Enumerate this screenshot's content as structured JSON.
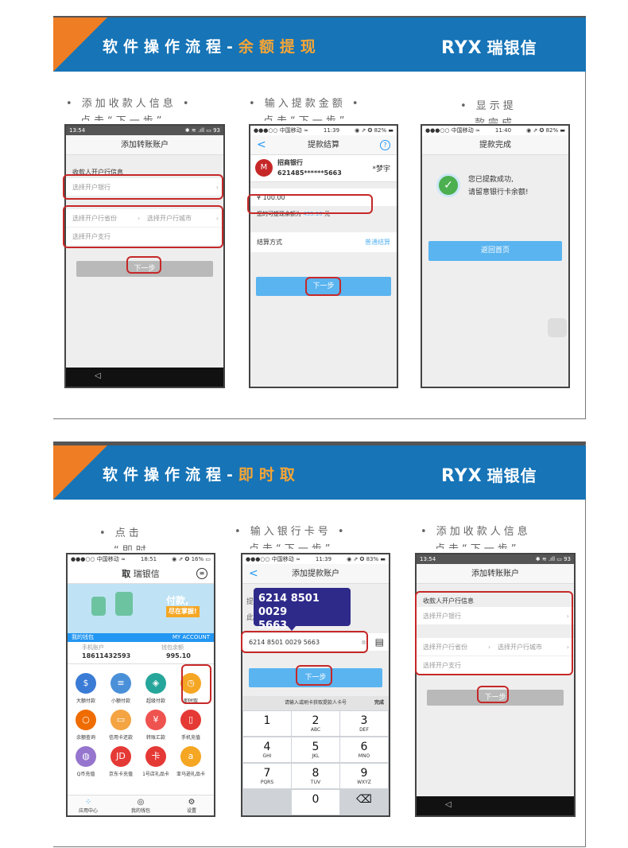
{
  "slide1": {
    "title_prefix": "软件操作流程-",
    "title_hl": "余额提现",
    "logo_en": "RYX",
    "logo_cn": "瑞银信",
    "caption1": "• 添加收款人信息  •",
    "caption1b": "点击“下一步”",
    "caption2": "• 输入提款金额  •",
    "caption2b": "点击“下一步”",
    "caption3": "• 显示提",
    "caption3b": "款完成",
    "phone1": {
      "status_left": "13:54",
      "status_right": "✱ ≋ .ıll ▭ 93",
      "nav_title": "添加转账账户",
      "section": "收款人开户行信息",
      "bank_placeholder": "选择开户银行",
      "province_placeholder": "选择开户行省份",
      "city_placeholder": "选择开户行城市",
      "branch_placeholder": "选择开户支行",
      "next": "下一步",
      "back": "◁"
    },
    "phone2": {
      "status_left": "●●●○○ 中国移动 ≈",
      "status_time": "11:39",
      "status_right": "◉ ⇗ ✪ 82% ▬",
      "back": "<",
      "nav_title": "提款结算",
      "help": "?",
      "bank_name": "招商银行",
      "card_no": "621485******5663",
      "holder": "*梦宇",
      "amount": "¥ 100.00",
      "avail_prefix": "您的可提现余额为",
      "avail_value": "495.10",
      "avail_suffix": "元",
      "settle_label": "结算方式",
      "settle_value": "普通结算",
      "next": "下一步"
    },
    "phone3": {
      "status_left": "●●●○○ 中国移动 ≈",
      "status_time": "11:40",
      "status_right": "◉ ⇗ ✪ 82% ▬",
      "nav_title": "提款完成",
      "msg1": "您已提款成功,",
      "msg2": "请留意银行卡余额!",
      "home": "返回首页"
    }
  },
  "slide2": {
    "title_prefix": "软件操作流程-",
    "title_hl": "即时取",
    "logo_en": "RYX",
    "logo_cn": "瑞银信",
    "caption1": "• 点击",
    "caption1b": "“即时",
    "caption2": "• 输入银行卡号  •",
    "caption2b": "点击“下一步”",
    "caption3": "• 添加收款人信息",
    "caption3b": "点击“下一步”",
    "phone4": {
      "status_left": "●●●○○ 中国移动 ≈",
      "status_time": "18:51",
      "status_right": "◉ ⇗ ✪ 16% ▭",
      "header_prefix": "取",
      "header_title": "瑞银信",
      "banner_text1": "付款,",
      "banner_text2": "尽在掌握!",
      "wallet_left": "我的钱包",
      "wallet_right": "MY ACCOUNT",
      "acct_label": "手机账户",
      "acct_value": "18611432593",
      "bal_label": "钱包余额",
      "bal_value": "995.10",
      "icons": [
        {
          "label": "大额付款",
          "glyph": "$",
          "color": "#3a7bd5"
        },
        {
          "label": "小额付款",
          "glyph": "≡",
          "color": "#4a90d9"
        },
        {
          "label": "超级付款",
          "glyph": "◈",
          "color": "#26a69a"
        },
        {
          "label": "即时取",
          "glyph": "◷",
          "color": "#f5a623"
        },
        {
          "label": "余额查询",
          "glyph": "○",
          "color": "#ef6c00"
        },
        {
          "label": "信用卡还款",
          "glyph": "▭",
          "color": "#f4a442"
        },
        {
          "label": "转账汇款",
          "glyph": "¥",
          "color": "#ef5350"
        },
        {
          "label": "手机充值",
          "glyph": "▯",
          "color": "#e53935"
        },
        {
          "label": "Q币充值",
          "glyph": "◍",
          "color": "#9575cd"
        },
        {
          "label": "京东卡充值",
          "glyph": "JD",
          "color": "#e53935"
        },
        {
          "label": "1号店礼品卡",
          "glyph": "卡",
          "color": "#e53935"
        },
        {
          "label": "亚马逊礼品卡",
          "glyph": "a",
          "color": "#f5a623"
        }
      ],
      "tab1": "应用中心",
      "tab2": "我的钱包",
      "tab3": "设置"
    },
    "phone5": {
      "status_left": "●●●○○ 中国移动 ≈",
      "status_time": "11:39",
      "status_right": "◉ ⇗ ✪ 83% ▬",
      "back": "<",
      "nav_title": "添加提款账户",
      "tip_line1": "6214 8501 0029",
      "tip_line2": "5663",
      "card_input": "6214 8501 0029 5663",
      "side1": "提",
      "side2": "此",
      "next": "下一步",
      "kb_hint": "请输入或刷卡获取提款人卡号",
      "kb_done": "完成",
      "keys": [
        {
          "n": "1",
          "s": ""
        },
        {
          "n": "2",
          "s": "ABC"
        },
        {
          "n": "3",
          "s": "DEF"
        },
        {
          "n": "4",
          "s": "GHI"
        },
        {
          "n": "5",
          "s": "JKL"
        },
        {
          "n": "6",
          "s": "MNO"
        },
        {
          "n": "7",
          "s": "PQRS"
        },
        {
          "n": "8",
          "s": "TUV"
        },
        {
          "n": "9",
          "s": "WXYZ"
        },
        {
          "n": "",
          "s": ""
        },
        {
          "n": "0",
          "s": ""
        },
        {
          "n": "⌫",
          "s": ""
        }
      ]
    },
    "phone6": {
      "status_left": "13:54",
      "status_right": "✱ ≋ .ıll ▭ 93",
      "nav_title": "添加转账账户",
      "section": "收款人开户行信息",
      "bank_placeholder": "选择开户银行",
      "province_placeholder": "选择开户行省份",
      "city_placeholder": "选择开户行城市",
      "branch_placeholder": "选择开户支行",
      "next": "下一步",
      "back": "◁"
    }
  }
}
